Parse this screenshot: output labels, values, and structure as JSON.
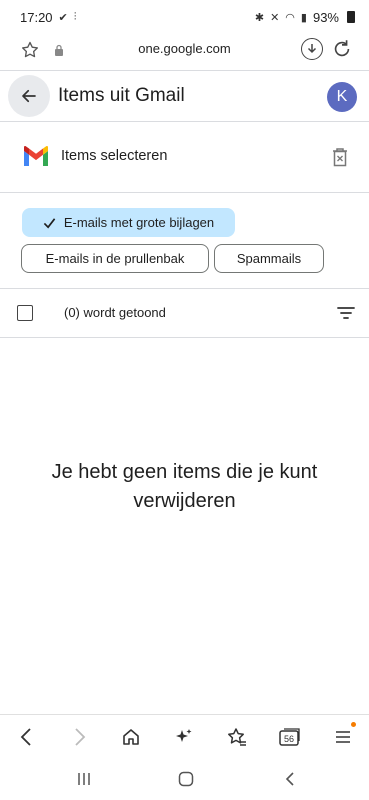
{
  "status_bar": {
    "time": "17:20",
    "battery": "93%"
  },
  "browser": {
    "url": "one.google.com",
    "tab_count": "56"
  },
  "header": {
    "title": "Items uit Gmail",
    "avatar_initial": "K"
  },
  "items": {
    "label": "Items selecteren"
  },
  "filters": [
    {
      "label": "E-mails met grote bijlagen",
      "selected": true
    },
    {
      "label": "E-mails in de prullenbak",
      "selected": false
    },
    {
      "label": "Spammails",
      "selected": false
    }
  ],
  "list": {
    "count_text": "(0) wordt getoond"
  },
  "empty_state": {
    "message": "Je hebt geen items die je kunt verwijderen"
  },
  "colors": {
    "selected_chip": "#c2e7ff",
    "avatar": "#5c6bc0",
    "notification_dot": "#f57c00"
  }
}
